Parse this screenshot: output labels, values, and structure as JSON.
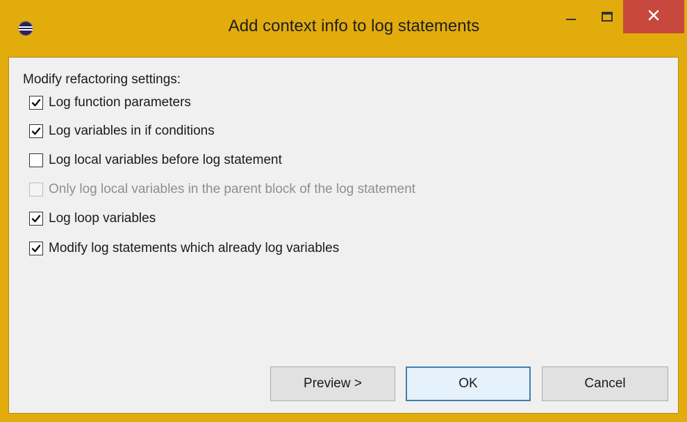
{
  "window": {
    "title": "Add context info to log statements",
    "app_icon": "eclipse-icon",
    "controls": {
      "minimize": "minimize-icon",
      "maximize": "maximize-icon",
      "close": "close-icon"
    }
  },
  "settings": {
    "label": "Modify refactoring settings:",
    "options": [
      {
        "label": "Log function parameters",
        "checked": true,
        "enabled": true
      },
      {
        "label": "Log variables in if conditions",
        "checked": true,
        "enabled": true
      },
      {
        "label": "Log local variables before log statement",
        "checked": false,
        "enabled": true
      },
      {
        "label": "Only log local variables in the parent block of the log statement",
        "checked": false,
        "enabled": false
      },
      {
        "label": "Log loop variables",
        "checked": true,
        "enabled": true
      },
      {
        "label": "Modify log statements which already log variables",
        "checked": true,
        "enabled": true
      }
    ]
  },
  "buttons": {
    "preview": "Preview >",
    "ok": "OK",
    "cancel": "Cancel"
  },
  "colors": {
    "title_bar": "#e2ac0d",
    "close_button": "#c8483e",
    "dialog_bg": "#f0f0f0",
    "default_button_border": "#3c7fb1"
  }
}
